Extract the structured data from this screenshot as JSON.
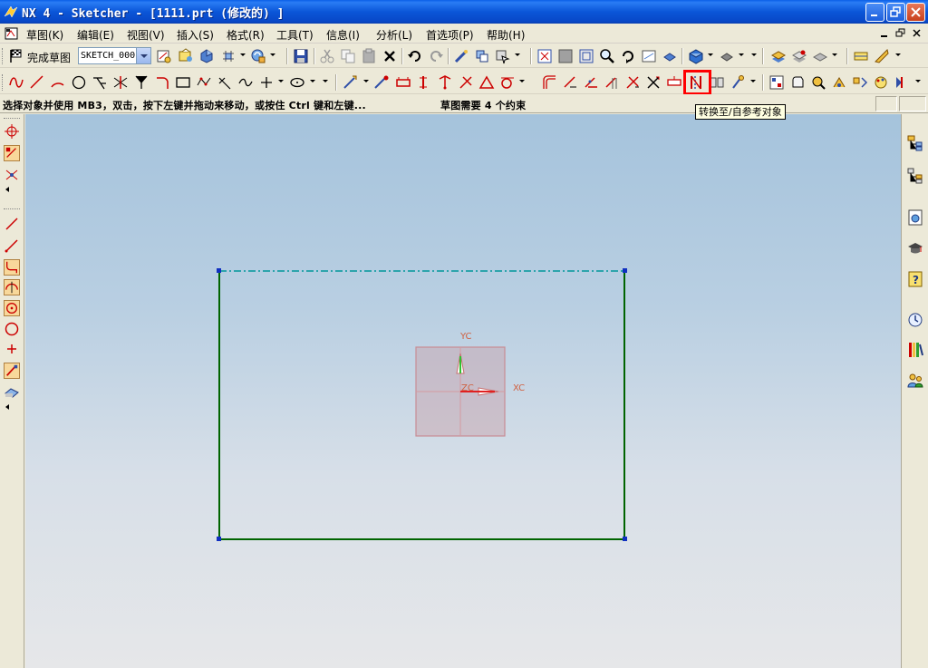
{
  "window": {
    "title": "NX 4 - Sketcher - [1111.prt (修改的) ]"
  },
  "menubar": {
    "items": [
      {
        "label": "草图(K)"
      },
      {
        "label": "编辑(E)"
      },
      {
        "label": "视图(V)"
      },
      {
        "label": "插入(S)"
      },
      {
        "label": "格式(R)"
      },
      {
        "label": "工具(T)"
      },
      {
        "label": "信息(I)"
      },
      {
        "label": "分析(L)"
      },
      {
        "label": "首选项(P)"
      },
      {
        "label": "帮助(H)"
      }
    ]
  },
  "sketch_toolbar": {
    "finish_label": "完成草图",
    "sketch_name": "SKETCH_000"
  },
  "status": {
    "prompt": "选择对象并使用 MB3，双击，按下左键并拖动来移动，或按住 Ctrl 键和左键...",
    "constraint_status": "草图需要 4 个约束"
  },
  "tooltip": {
    "text": "转换至/自参考对象"
  },
  "csys": {
    "x_label": "XC",
    "y_label": "YC",
    "z_label": "ZC"
  },
  "colors": {
    "rectangle_solid": "#006400",
    "rectangle_reference": "#00969b",
    "csys_plane": "#c8a0a8",
    "highlight": "#ff0000"
  }
}
